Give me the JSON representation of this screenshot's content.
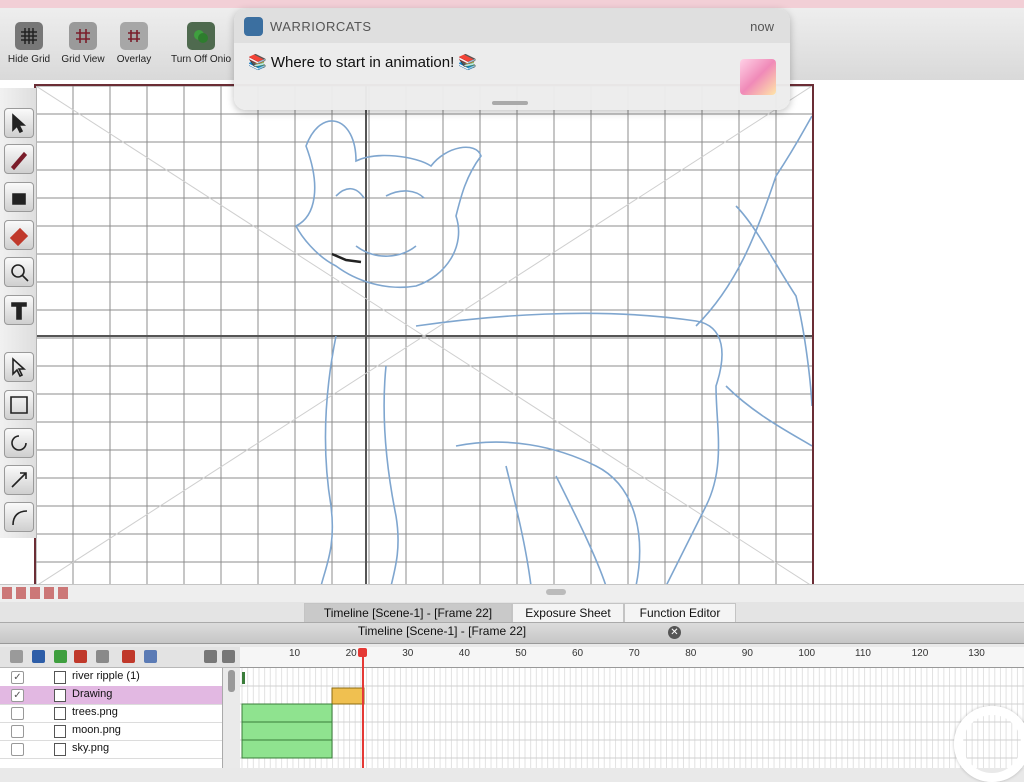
{
  "toolbar": {
    "buttons": [
      {
        "label": "Hide Grid",
        "icon": "hide-grid-icon"
      },
      {
        "label": "Grid View",
        "icon": "grid-view-icon"
      },
      {
        "label": "Overlay",
        "icon": "overlay-icon"
      },
      {
        "label": "Turn Off Onio",
        "icon": "onion-skin-icon"
      }
    ]
  },
  "notification": {
    "app_name": "WARRIORCATS",
    "time": "now",
    "message": "📚 Where to start in animation! 📚"
  },
  "tools": [
    "select-icon",
    "brush-icon",
    "paint-bucket-icon",
    "eraser-icon",
    "zoom-icon",
    "text-icon",
    "contour-select-icon",
    "transform-icon",
    "rotate-icon",
    "scale-icon",
    "skew-icon"
  ],
  "tabs": {
    "timeline": "Timeline [Scene-1] - [Frame 22]",
    "exposure": "Exposure Sheet",
    "function": "Function Editor"
  },
  "timeline": {
    "title": "Timeline [Scene-1] - [Frame 22]",
    "current_frame": 22,
    "ruler": [
      "10",
      "20",
      "30",
      "40",
      "50",
      "60",
      "70",
      "80",
      "90",
      "100",
      "110",
      "120",
      "130"
    ],
    "layers": [
      {
        "name": "river ripple (1)",
        "checked": true
      },
      {
        "name": "Drawing",
        "checked": true,
        "selected": true
      },
      {
        "name": "trees.png",
        "checked": false
      },
      {
        "name": "moon.png",
        "checked": false
      },
      {
        "name": "sky.png",
        "checked": false
      }
    ]
  },
  "colors": {
    "selection": "#e2b8e2",
    "playhead": "#e53935",
    "frame_green": "#8fe38f",
    "frame_yellow": "#f0c050",
    "sketch_blue": "#7fa6cf",
    "canvas_border": "#6b2d35"
  }
}
